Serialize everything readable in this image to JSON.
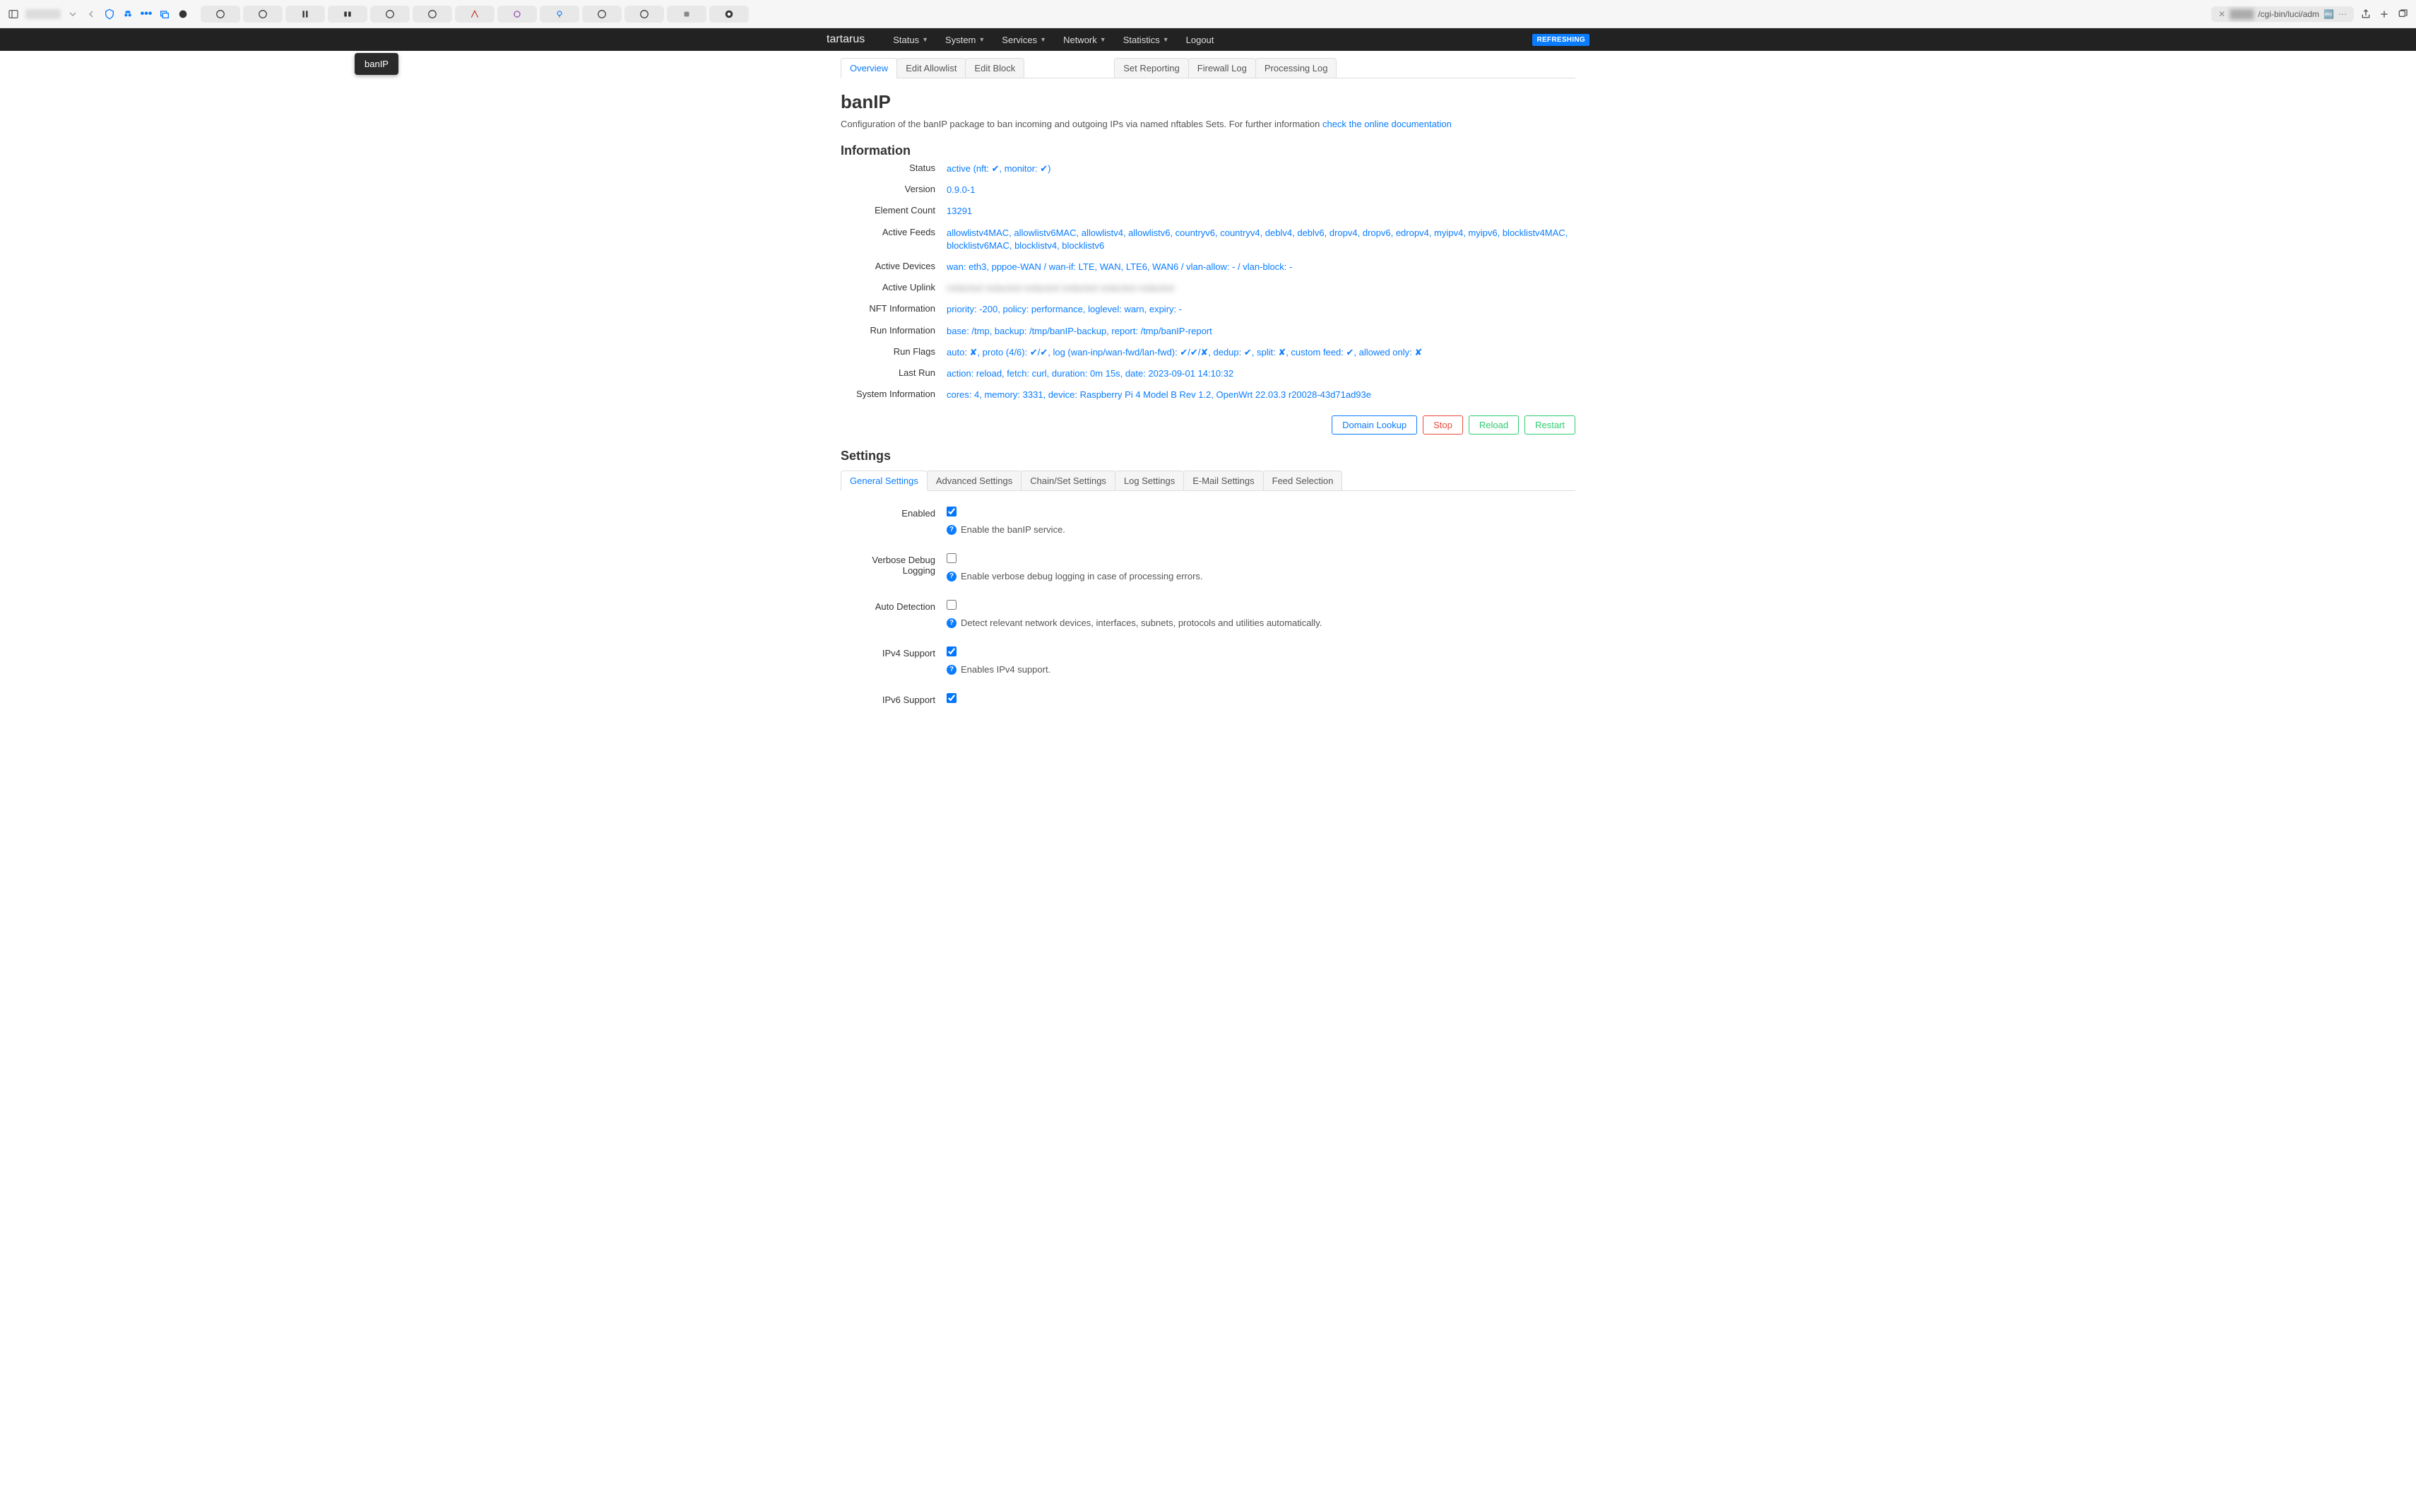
{
  "browser": {
    "address": "/cgi-bin/luci/adm"
  },
  "topnav": {
    "brand": "tartarus",
    "items": [
      {
        "label": "Status",
        "caret": true
      },
      {
        "label": "System",
        "caret": true
      },
      {
        "label": "Services",
        "caret": true
      },
      {
        "label": "Network",
        "caret": true
      },
      {
        "label": "Statistics",
        "caret": true
      },
      {
        "label": "Logout",
        "caret": false
      }
    ],
    "refreshing": "REFRESHING",
    "dropdown_tip": "banIP"
  },
  "subtabs": [
    "Overview",
    "Edit Allowlist",
    "Edit Block",
    "Set Reporting",
    "Firewall Log",
    "Processing Log"
  ],
  "heading": {
    "title": "banIP",
    "desc_prefix": "Configuration of the banIP package to ban incoming and outgoing IPs via named nftables Sets. For further information ",
    "desc_link": "check the online documentation"
  },
  "info_heading": "Information",
  "info": [
    {
      "label": "Status",
      "value": "active (nft: ✔, monitor: ✔)"
    },
    {
      "label": "Version",
      "value": "0.9.0-1"
    },
    {
      "label": "Element Count",
      "value": "13291"
    },
    {
      "label": "Active Feeds",
      "value": "allowlistv4MAC, allowlistv6MAC, allowlistv4, allowlistv6, countryv6, countryv4, deblv4, deblv6, dropv4, dropv6, edropv4, myipv4, myipv6, blocklistv4MAC, blocklistv6MAC, blocklistv4, blocklistv6"
    },
    {
      "label": "Active Devices",
      "value": "wan: eth3, pppoe-WAN / wan-if: LTE, WAN, LTE6, WAN6 / vlan-allow: - / vlan-block: -"
    },
    {
      "label": "Active Uplink",
      "value": "redacted redacted redacted redacted redacted redacted",
      "blurred": true
    },
    {
      "label": "NFT Information",
      "value": "priority: -200, policy: performance, loglevel: warn, expiry: -"
    },
    {
      "label": "Run Information",
      "value": "base: /tmp, backup: /tmp/banIP-backup, report: /tmp/banIP-report"
    },
    {
      "label": "Run Flags",
      "value": "auto: ✘, proto (4/6): ✔/✔, log (wan-inp/wan-fwd/lan-fwd): ✔/✔/✘, dedup: ✔, split: ✘, custom feed: ✔, allowed only: ✘"
    },
    {
      "label": "Last Run",
      "value": "action: reload, fetch: curl, duration: 0m 15s, date: 2023-09-01 14:10:32"
    },
    {
      "label": "System Information",
      "value": "cores: 4, memory: 3331, device: Raspberry Pi 4 Model B Rev 1.2, OpenWrt 22.03.3 r20028-43d71ad93e"
    }
  ],
  "actions": {
    "lookup": "Domain Lookup",
    "stop": "Stop",
    "reload": "Reload",
    "restart": "Restart"
  },
  "settings_heading": "Settings",
  "settings_tabs": [
    "General Settings",
    "Advanced Settings",
    "Chain/Set Settings",
    "Log Settings",
    "E-Mail Settings",
    "Feed Selection"
  ],
  "settings_fields": [
    {
      "label": "Enabled",
      "checked": true,
      "help": "Enable the banIP service."
    },
    {
      "label": "Verbose Debug Logging",
      "checked": false,
      "help": "Enable verbose debug logging in case of processing errors."
    },
    {
      "label": "Auto Detection",
      "checked": false,
      "help": "Detect relevant network devices, interfaces, subnets, protocols and utilities automatically."
    },
    {
      "label": "IPv4 Support",
      "checked": true,
      "help": "Enables IPv4 support."
    },
    {
      "label": "IPv6 Support",
      "checked": true,
      "help": ""
    }
  ]
}
